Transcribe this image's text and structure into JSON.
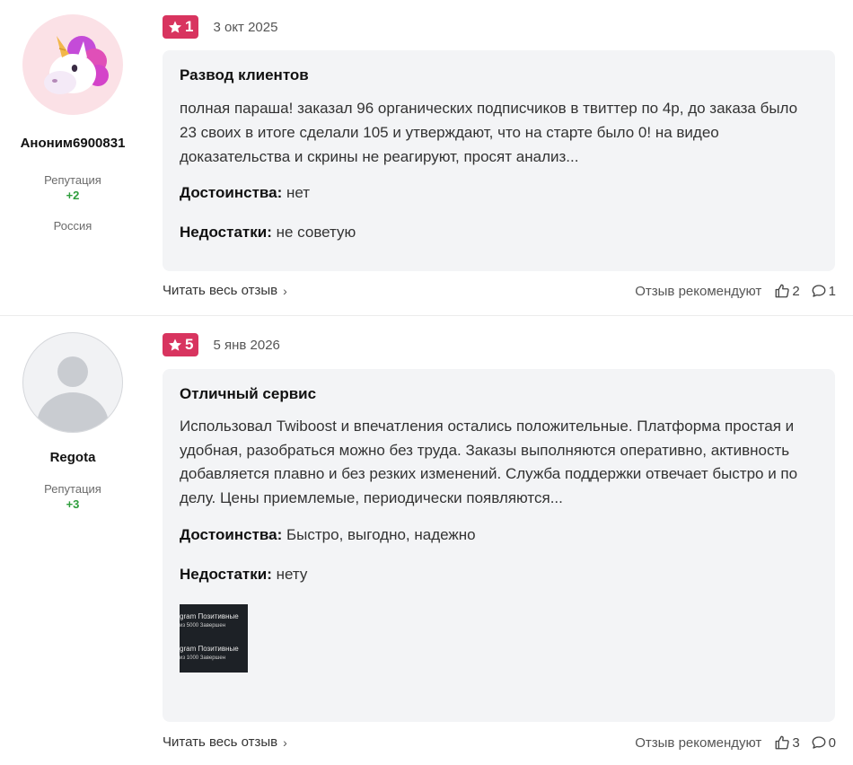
{
  "reviews": [
    {
      "rating": "1",
      "date": "3 окт 2025",
      "author": {
        "name": "Аноним6900831",
        "reputation_label": "Репутация",
        "reputation": "+2",
        "country": "Россия",
        "avatar_icon": "unicorn-icon"
      },
      "title": "Развод клиентов",
      "text": "полная параша! заказал 96 органических подписчиков в твиттер по 4р, до заказа было 23 своих в итоге сделали 105 и утверждают, что на старте было 0! на видео доказательства и скрины не реагируют, просят анализ...",
      "pros_label": "Достоинства:",
      "pros": "нет",
      "cons_label": "Недостатки:",
      "cons": "не советую",
      "read_more": "Читать весь отзыв",
      "recommend_label": "Отзыв рекомендуют",
      "likes": "2",
      "comments": "1"
    },
    {
      "rating": "5",
      "date": "5 янв 2026",
      "author": {
        "name": "Regota",
        "reputation_label": "Репутация",
        "reputation": "+3",
        "avatar_icon": "default-user-icon"
      },
      "title": "Отличный сервис",
      "text": "Использовал Twiboost и впечатления остались положительные. Платформа простая и удобная, разобраться можно без труда. Заказы выполняются оперативно, активность добавляется плавно и без резких изменений. Служба поддержки отвечает быстро и по делу. Цены приемлемые, периодически появляются...",
      "pros_label": "Достоинства:",
      "pros": "Быстро, выгодно, надежно",
      "cons_label": "Недостатки:",
      "cons": "нету",
      "thumb": {
        "line1": "gram Позитивные",
        "line2": "из 5000 Завершен",
        "line3": "gram Позитивные",
        "line4": "из 1000 Завершен"
      },
      "read_more": "Читать весь отзыв",
      "recommend_label": "Отзыв рекомендуют",
      "likes": "3",
      "comments": "0"
    }
  ],
  "colors": {
    "rating_badge": "#d8345f",
    "reputation": "#2e9e3c",
    "card_bg": "#f3f4f6"
  },
  "icons": {
    "star": "star-icon",
    "like": "thumbs-up-icon",
    "comment": "comment-icon",
    "chevron": "chevron-right-icon"
  }
}
